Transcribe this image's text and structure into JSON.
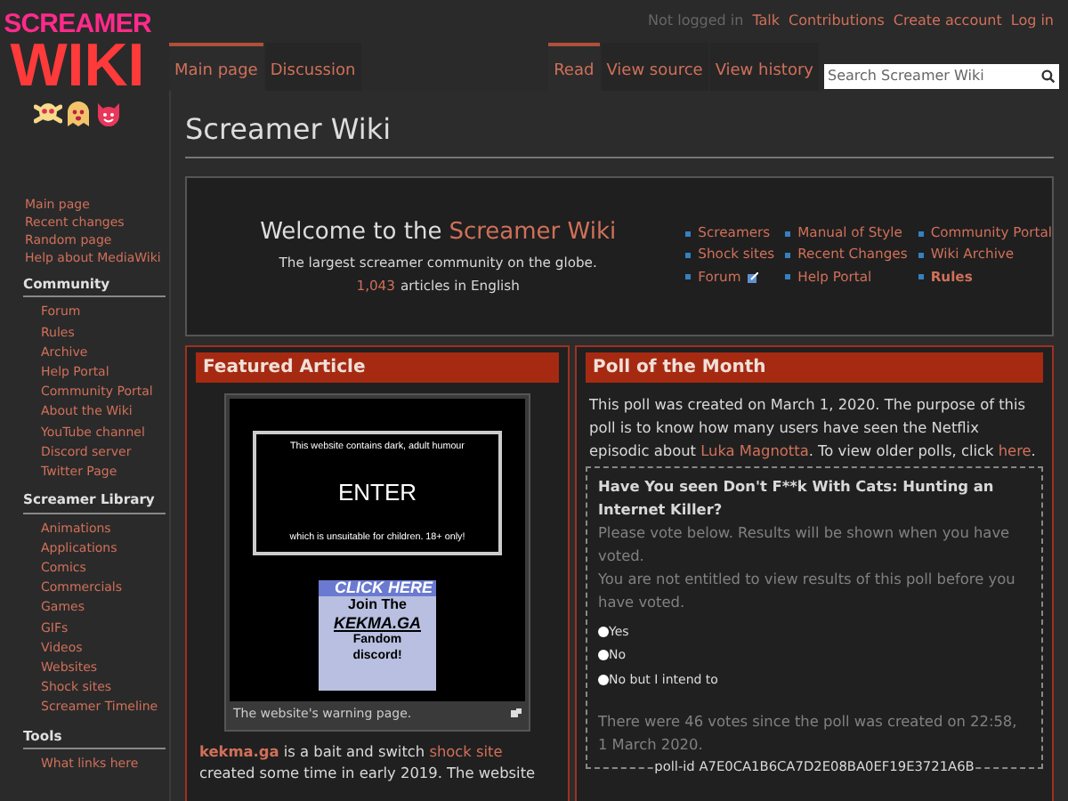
{
  "logo": {
    "line_1": "SCREAMER",
    "line_2": "WIKI"
  },
  "personal_tools": {
    "status": "Not logged in",
    "links": [
      "Talk",
      "Contributions",
      "Create account",
      "Log in"
    ]
  },
  "namespace_tabs": [
    {
      "label": "Main page",
      "selected": true
    },
    {
      "label": "Discussion",
      "selected": false
    }
  ],
  "view_tabs": [
    {
      "label": "Read",
      "selected": true
    },
    {
      "label": "View source",
      "selected": false
    },
    {
      "label": "View history",
      "selected": false
    }
  ],
  "search": {
    "placeholder": "Search Screamer Wiki"
  },
  "sidebar": {
    "navigation": [
      "Main page",
      "Recent changes",
      "Random page",
      "Help about MediaWiki"
    ],
    "sections": [
      {
        "heading": "Community",
        "items": [
          "Forum",
          "Rules",
          "Archive",
          "Help Portal",
          "Community Portal",
          "About the Wiki",
          "YouTube channel",
          "Discord server",
          "Twitter Page"
        ]
      },
      {
        "heading": "Screamer Library",
        "items": [
          "Animations",
          "Applications",
          "Comics",
          "Commercials",
          "Games",
          "GIFs",
          "Videos",
          "Websites",
          "Shock sites",
          "Screamer Timeline"
        ]
      },
      {
        "heading": "Tools",
        "items": [
          "What links here"
        ]
      }
    ]
  },
  "page_title": "Screamer Wiki",
  "welcome": {
    "title_start": "Welcome to the",
    "title_link": "Screamer Wiki",
    "tagline": "The largest screamer community on the globe.",
    "count": "1,043",
    "count_suffix": "articles in English",
    "link_columns": [
      [
        {
          "label": "Screamers",
          "external": false,
          "bold": false
        },
        {
          "label": "Shock sites",
          "external": false,
          "bold": false
        },
        {
          "label": "Forum",
          "external": true,
          "bold": false
        }
      ],
      [
        {
          "label": "Manual of Style",
          "external": false,
          "bold": false
        },
        {
          "label": "Recent Changes",
          "external": false,
          "bold": false
        },
        {
          "label": "Help Portal",
          "external": false,
          "bold": false
        }
      ],
      [
        {
          "label": "Community Portal",
          "external": false,
          "bold": false
        },
        {
          "label": "Wiki Archive",
          "external": false,
          "bold": false
        },
        {
          "label": "Rules",
          "external": false,
          "bold": true
        }
      ]
    ]
  },
  "featured": {
    "heading": "Featured Article",
    "image": {
      "warning_top": "This website contains dark, adult humour",
      "enter": "ENTER",
      "warning_bottom": "which is unsuitable for children. 18+ only!",
      "banner_click": "CLICK HERE",
      "banner_join": "Join The",
      "banner_site": "KEKMA.GA",
      "banner_fandom": "Fandom discord!"
    },
    "caption": "The website's warning page.",
    "text": [
      {
        "kind": "bold_link",
        "text": "kekma.ga"
      },
      {
        "kind": "text",
        "text": " is a bait and switch "
      },
      {
        "kind": "link",
        "text": "shock site"
      },
      {
        "kind": "text",
        "text": " created some time in early 2019. The website"
      }
    ]
  },
  "poll": {
    "heading": "Poll of the Month",
    "intro": [
      {
        "kind": "text",
        "text": "This poll was created on March 1, 2020. The purpose of this poll is to know how many users have seen the Netflix episodic about "
      },
      {
        "kind": "link",
        "text": "Luka Magnotta"
      },
      {
        "kind": "text",
        "text": ". To view older polls, click "
      },
      {
        "kind": "link",
        "text": "here"
      },
      {
        "kind": "text",
        "text": "."
      }
    ],
    "question": "Have You seen Don't F**k With Cats: Hunting an Internet Killer?",
    "notes": [
      "Please vote below. Results will be shown when you have voted.",
      "You are not entitled to view results of this poll before you have voted."
    ],
    "options": [
      {
        "label": "Yes",
        "selected": false
      },
      {
        "label": "No",
        "selected": false
      },
      {
        "label": "No but I intend to",
        "selected": false
      }
    ],
    "footer": "There were 46 votes since the poll was created on 22:58, 1 March 2020.",
    "poll_id": "poll-id A7E0CA1B6CA7D2E08BA0EF19E3721A6B"
  }
}
